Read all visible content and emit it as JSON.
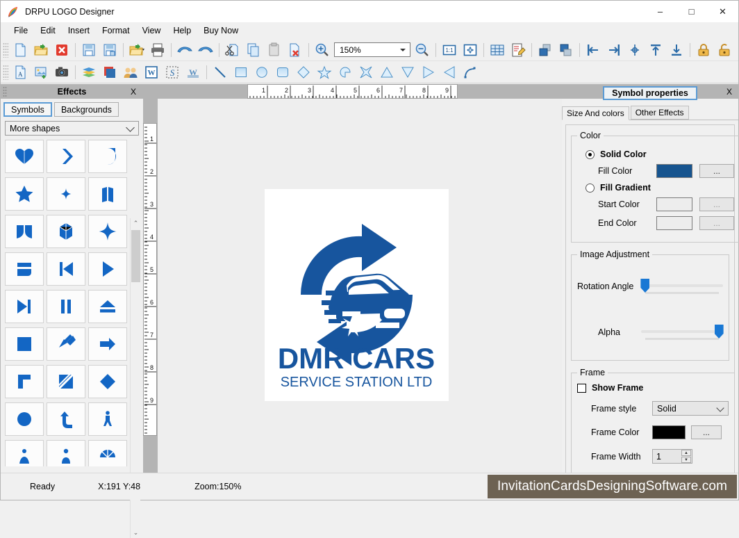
{
  "window": {
    "title": "DRPU LOGO Designer",
    "icon": "app-logo-icon",
    "minimize": "–",
    "maximize": "□",
    "close": "✕"
  },
  "menu": {
    "items": [
      "File",
      "Edit",
      "Insert",
      "Format",
      "View",
      "Help",
      "Buy Now"
    ]
  },
  "toolbar_row1": {
    "zoom_value": "150%",
    "buttons": [
      "new-document-icon",
      "open-folder-icon",
      "close-document-icon",
      "save-icon",
      "save-as-icon",
      "export-icon",
      "print-icon",
      "undo-icon",
      "redo-icon",
      "cut-icon",
      "copy-icon",
      "paste-icon",
      "delete-icon",
      "zoom-in-icon",
      "zoom-out-icon",
      "actual-size-icon",
      "fit-page-icon",
      "grid-icon",
      "edit-properties-icon",
      "bring-forward-icon",
      "send-backward-icon",
      "align-left-icon",
      "align-right-icon",
      "align-center-icon",
      "align-top-icon",
      "align-bottom-icon",
      "lock-icon",
      "unlock-icon"
    ]
  },
  "toolbar_row2": {
    "buttons": [
      "add-text-icon",
      "add-image-icon",
      "camera-icon",
      "layers-icon",
      "background-icon",
      "clipart-people-icon",
      "word-art-icon",
      "signature-icon",
      "watermark-icon",
      "line-icon",
      "rectangle-icon",
      "ellipse-icon",
      "rounded-rect-icon",
      "diamond-icon",
      "star-icon",
      "pie-icon",
      "four-point-star-icon",
      "triangle-icon",
      "triangle-down-icon",
      "triangle-right-icon",
      "triangle-left-icon",
      "arc-icon"
    ]
  },
  "left_panel": {
    "title": "Effects",
    "close_label": "X",
    "tabs": [
      {
        "label": "Symbols",
        "selected": true
      },
      {
        "label": "Backgrounds",
        "selected": false
      }
    ],
    "category": "More shapes",
    "symbols": [
      "heart-symbol",
      "chevron-right-symbol",
      "pac-shape-symbol",
      "star-symbol",
      "sparkle-small-symbol",
      "open-book-symbol",
      "leaf-pair-symbol",
      "cube-symbol",
      "four-point-star-symbol",
      "stacked-bars-symbol",
      "skip-back-symbol",
      "play-symbol",
      "skip-forward-symbol",
      "pause-symbol",
      "eject-symbol",
      "square-symbol",
      "arrow-down-left-symbol",
      "arrow-right-symbol",
      "corner-symbol",
      "split-square-symbol",
      "rhombus-symbol",
      "circle-symbol",
      "curved-arrow-up-symbol",
      "walking-person-symbol",
      "sitting-person-symbol",
      "person-symbol",
      "gauge-symbol"
    ],
    "scroll_up": "⌃",
    "scroll_down": "⌄"
  },
  "canvas": {
    "h_ruler_ticks": [
      "1",
      "2",
      "3",
      "4",
      "5",
      "6",
      "7",
      "8",
      "9"
    ],
    "v_ruler_ticks": [
      "1",
      "2",
      "3",
      "4",
      "5",
      "6",
      "7",
      "8",
      "9"
    ],
    "logo": {
      "title": "DMR CARS",
      "subtitle": "SERVICE STATION LTD",
      "color": "#17559e"
    }
  },
  "right_panel": {
    "title": "Symbol properties",
    "close_label": "X",
    "tabs": [
      {
        "label": "Size And colors",
        "selected": true
      },
      {
        "label": "Other Effects",
        "selected": false
      }
    ],
    "color_group": {
      "legend": "Color",
      "solid_color_label": "Solid Color",
      "solid_selected": true,
      "fill_color_label": "Fill Color",
      "fill_color_value": "#16548f",
      "fill_color_button": "...",
      "fill_gradient_label": "Fill Gradient",
      "gradient_selected": false,
      "start_color_label": "Start Color",
      "start_color_value": "#ededed",
      "start_color_button": "...",
      "end_color_label": "End Color",
      "end_color_value": "#ededed",
      "end_color_button": "..."
    },
    "image_adjustment": {
      "legend": "Image Adjustment",
      "rotation_label": "Rotation Angle",
      "rotation_percent": 2,
      "alpha_label": "Alpha",
      "alpha_percent": 98
    },
    "frame": {
      "legend": "Frame",
      "show_frame_label": "Show Frame",
      "show_frame_checked": false,
      "style_label": "Frame style",
      "style_value": "Solid",
      "color_label": "Frame Color",
      "color_value": "#000000",
      "color_button": "...",
      "width_label": "Frame Width",
      "width_value": "1",
      "spin_up": "▲",
      "spin_down": "▼"
    }
  },
  "statusbar": {
    "ready": "Ready",
    "coords": "X:191  Y:48",
    "zoom": "Zoom:150%",
    "brand": "InvitationCardsDesigningSoftware.com"
  }
}
